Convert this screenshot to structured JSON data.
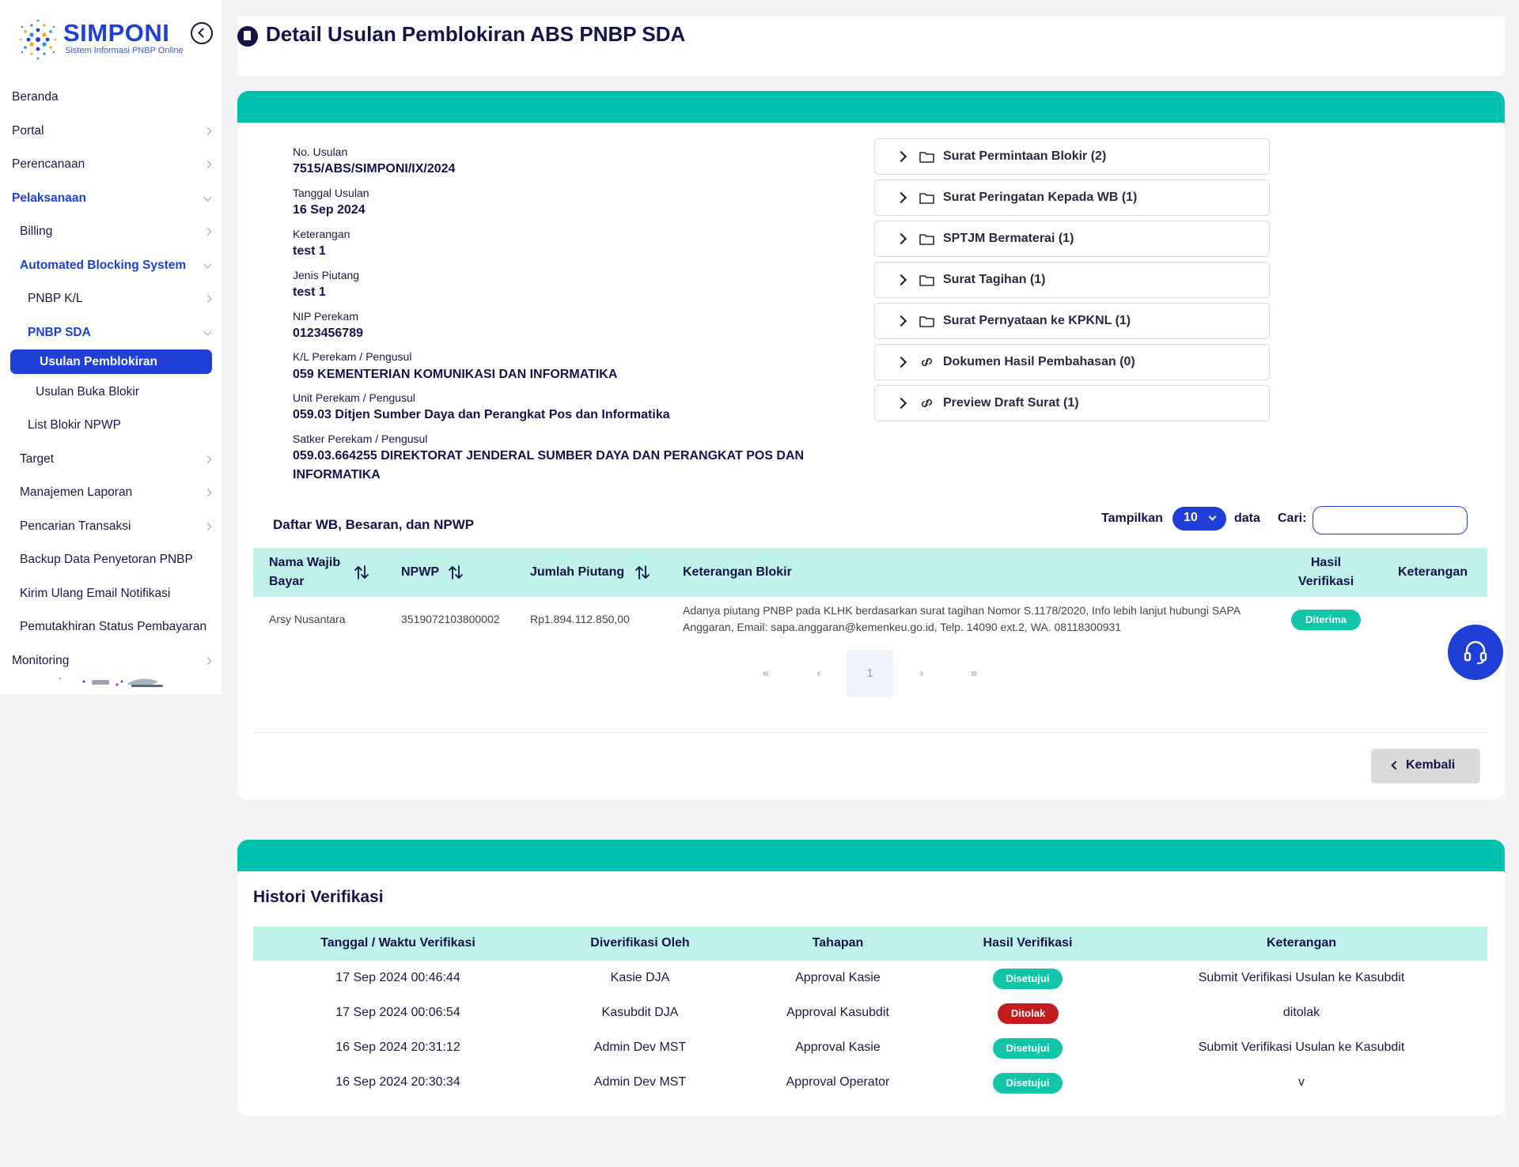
{
  "app": {
    "logo_text": "SIMPONI",
    "logo_sub": "Sistem Informasi PNBP Online"
  },
  "sidebar": {
    "items": [
      {
        "label": "Beranda"
      },
      {
        "label": "Portal"
      },
      {
        "label": "Perencanaan"
      },
      {
        "label": "Pelaksanaan"
      },
      {
        "label": "Billing"
      },
      {
        "label": "Automated Blocking System"
      },
      {
        "label": "PNBP K/L"
      },
      {
        "label": "PNBP SDA"
      },
      {
        "label": "Usulan Pemblokiran"
      },
      {
        "label": "Usulan Buka Blokir"
      },
      {
        "label": "List Blokir NPWP"
      },
      {
        "label": "Target"
      },
      {
        "label": "Manajemen Laporan"
      },
      {
        "label": "Pencarian Transaksi"
      },
      {
        "label": "Backup Data Penyetoran PNBP"
      },
      {
        "label": "Kirim Ulang Email Notifikasi"
      },
      {
        "label": "Pemutakhiran Status Pembayaran"
      },
      {
        "label": "Monitoring"
      }
    ]
  },
  "header": {
    "title": "Detail Usulan Pemblokiran ABS PNBP SDA"
  },
  "detail": {
    "fields": [
      {
        "label": "No. Usulan",
        "value": "7515/ABS/SIMPONI/IX/2024"
      },
      {
        "label": "Tanggal Usulan",
        "value": "16 Sep 2024"
      },
      {
        "label": "Keterangan",
        "value": "test 1"
      },
      {
        "label": "Jenis Piutang",
        "value": "test 1"
      },
      {
        "label": "NIP Perekam",
        "value": "0123456789"
      },
      {
        "label": "K/L Perekam / Pengusul",
        "value": "059 KEMENTERIAN KOMUNIKASI DAN INFORMATIKA"
      },
      {
        "label": "Unit Perekam / Pengusul",
        "value": "059.03 Ditjen Sumber Daya dan Perangkat Pos dan Informatika"
      },
      {
        "label": "Satker Perekam / Pengusul",
        "value_line1": "059.03.664255 DIREKTORAT JENDERAL SUMBER DAYA DAN PERANGKAT POS DAN",
        "value_line2": "INFORMATIKA"
      }
    ],
    "documents": [
      {
        "label": "Surat Permintaan Blokir (2)",
        "icon": "folder-icon"
      },
      {
        "label": "Surat Peringatan Kepada WB (1)",
        "icon": "folder-icon"
      },
      {
        "label": "SPTJM Bermaterai (1)",
        "icon": "folder-icon"
      },
      {
        "label": "Surat Tagihan (1)",
        "icon": "folder-icon"
      },
      {
        "label": "Surat Pernyataan ke KPKNL (1)",
        "icon": "folder-icon"
      },
      {
        "label": "Dokumen Hasil Pembahasan (0)",
        "icon": "link-icon"
      },
      {
        "label": "Preview Draft Surat (1)",
        "icon": "link-icon"
      }
    ]
  },
  "wb_table": {
    "title": "Daftar WB, Besaran, dan NPWP",
    "show_label": "Tampilkan",
    "show_value": "10",
    "show_suffix": "data",
    "search_label": "Cari:",
    "search_value": "",
    "headers": {
      "nama_line1": "Nama Wajib",
      "nama_line2": "Bayar",
      "npwp": "NPWP",
      "jumlah": "Jumlah Piutang",
      "keterangan_blokir": "Keterangan Blokir",
      "hasil_line1": "Hasil",
      "hasil_line2": "Verifikasi",
      "keterangan": "Keterangan"
    },
    "rows": [
      {
        "nama": "Arsy Nusantara",
        "npwp": "3519072103800002",
        "jumlah": "Rp1.894.112.850,00",
        "ket_line1": "Adanya piutang PNBP pada KLHK berdasarkan surat tagihan Nomor S.1178/2020, Info lebih lanjut hubungi SAPA",
        "ket_line2": "Anggaran, Email: sapa.anggaran@kemenkeu.go.id, Telp. 14090 ext.2, WA. 08118300931",
        "hasil": "Diterima",
        "keterangan": ""
      }
    ],
    "pagination": {
      "first": "«",
      "prev": "‹",
      "current": "1",
      "next": "›",
      "last": "»"
    },
    "back_label": "Kembali"
  },
  "history": {
    "title": "Histori Verifikasi",
    "headers": [
      "Tanggal / Waktu Verifikasi",
      "Diverifikasi Oleh",
      "Tahapan",
      "Hasil Verifikasi",
      "Keterangan"
    ],
    "rows": [
      {
        "waktu": "17 Sep 2024 00:46:44",
        "oleh": "Kasie DJA",
        "tahapan": "Approval Kasie",
        "hasil": "Disetujui",
        "keterangan": "Submit Verifikasi Usulan ke Kasubdit"
      },
      {
        "waktu": "17 Sep 2024 00:06:54",
        "oleh": "Kasubdit DJA",
        "tahapan": "Approval Kasubdit",
        "hasil": "Ditolak",
        "keterangan": "ditolak"
      },
      {
        "waktu": "16 Sep 2024 20:31:12",
        "oleh": "Admin Dev MST",
        "tahapan": "Approval Kasie",
        "hasil": "Disetujui",
        "keterangan": "Submit Verifikasi Usulan ke Kasubdit"
      },
      {
        "waktu": "16 Sep 2024 20:30:34",
        "oleh": "Admin Dev MST",
        "tahapan": "Approval Operator",
        "hasil": "Disetujui",
        "keterangan": "v"
      }
    ]
  },
  "colors": {
    "primary": "#1f3fd6",
    "teal": "#00c1ad",
    "table_header": "#bff0ea",
    "success": "#12c4a8",
    "danger": "#c31c1c"
  }
}
